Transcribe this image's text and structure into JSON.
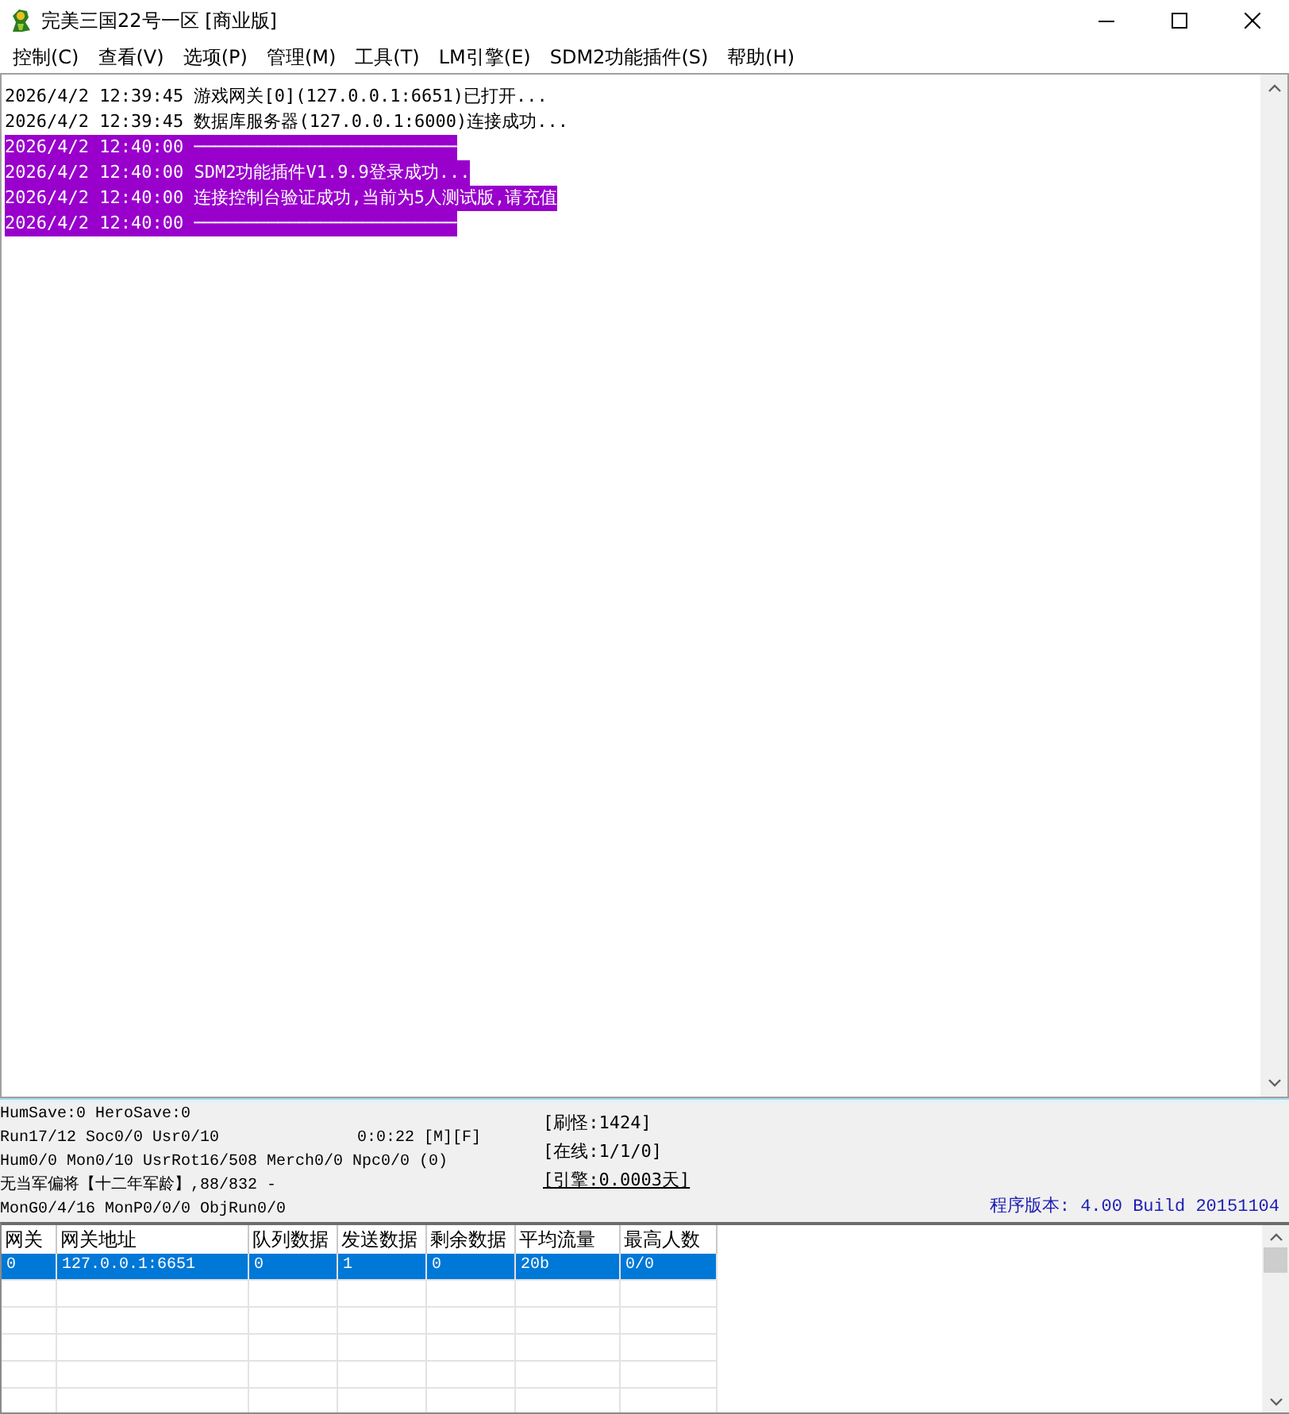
{
  "window": {
    "title": "完美三国22号一区 [商业版]"
  },
  "menu": [
    {
      "label": "控制(C)"
    },
    {
      "label": "查看(V)"
    },
    {
      "label": "选项(P)"
    },
    {
      "label": "管理(M)"
    },
    {
      "label": "工具(T)"
    },
    {
      "label": "LM引擎(E)"
    },
    {
      "label": "SDM2功能插件(S)"
    },
    {
      "label": "帮助(H)"
    }
  ],
  "log": [
    {
      "time": "2026/4/2 12:39:45",
      "message": "游戏网关[0](127.0.0.1:6651)已打开...",
      "highlighted": false
    },
    {
      "time": "2026/4/2 12:39:45",
      "message": "数据库服务器(127.0.0.1:6000)连接成功...",
      "highlighted": false
    },
    {
      "time": "2026/4/2 12:40:00",
      "message": "─────────────────────────",
      "highlighted": true
    },
    {
      "time": "2026/4/2 12:40:00",
      "message": "SDM2功能插件V1.9.9登录成功...",
      "highlighted": true
    },
    {
      "time": "2026/4/2 12:40:00",
      "message": "连接控制台验证成功,当前为5人测试版,请充值",
      "highlighted": true
    },
    {
      "time": "2026/4/2 12:40:00",
      "message": "─────────────────────────",
      "highlighted": true
    }
  ],
  "status": {
    "lines": [
      {
        "text": "HumSave:0 HeroSave:0"
      },
      {
        "text": "Run17/12 Soc0/0 Usr0/10",
        "aside": "0:0:22 [M][F]"
      },
      {
        "text": "Hum0/0 Mon0/10 UsrRot16/508 Merch0/0 Npc0/0 (0)"
      },
      {
        "text": "无当军偏将【十二年军龄】,88/832 -"
      },
      {
        "text": "MonG0/4/16 MonP0/0/0 ObjRun0/0"
      }
    ],
    "counters": [
      {
        "text": "[刷怪:1424]",
        "kind": "plain"
      },
      {
        "text": "[在线:1/1/0]",
        "kind": "plain"
      },
      {
        "text": "[引擎:0.0003天]",
        "kind": "link"
      }
    ],
    "version": "程序版本: 4.00 Build 20151104"
  },
  "table": {
    "columns": [
      "网关",
      "网关地址",
      "队列数据",
      "发送数据",
      "剩余数据",
      "平均流量",
      "最高人数"
    ],
    "rows": [
      {
        "cells": [
          "0",
          "127.0.0.1:6651",
          "0",
          "1",
          "0",
          "20b",
          "0/0"
        ],
        "selected": true
      }
    ]
  }
}
